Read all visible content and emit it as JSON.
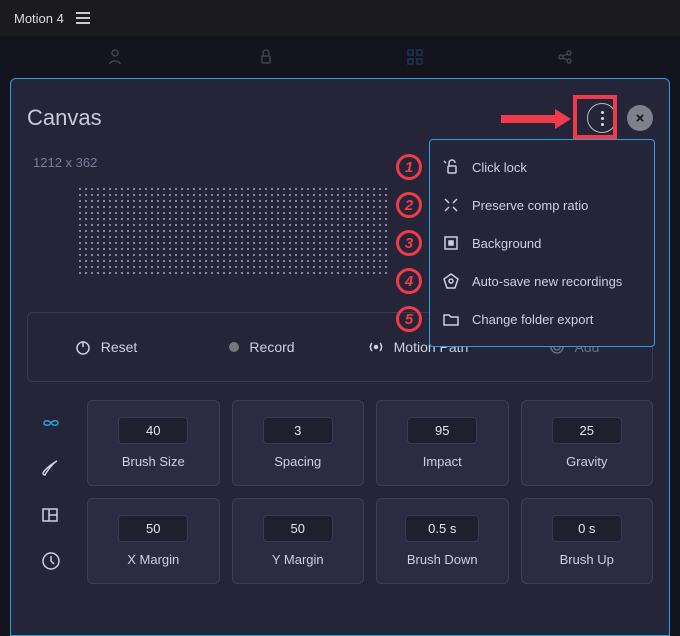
{
  "topbar": {
    "title": "Motion 4"
  },
  "panel": {
    "title": "Canvas",
    "dimensions": "1212 x 362"
  },
  "menu": {
    "items": [
      {
        "label": "Click lock",
        "icon": "lock-icon",
        "ann": "1"
      },
      {
        "label": "Preserve comp ratio",
        "icon": "expand-icon",
        "ann": "2"
      },
      {
        "label": "Background",
        "icon": "square-dot-icon",
        "ann": "3"
      },
      {
        "label": "Auto-save new recordings",
        "icon": "pentagon-icon",
        "ann": "4"
      },
      {
        "label": "Change folder export",
        "icon": "folder-icon",
        "ann": "5"
      }
    ]
  },
  "actions": {
    "reset": "Reset",
    "record": "Record",
    "motion_path": "Motion Path",
    "add": "Add"
  },
  "params": [
    {
      "value": "40",
      "label": "Brush Size"
    },
    {
      "value": "3",
      "label": "Spacing"
    },
    {
      "value": "95",
      "label": "Impact"
    },
    {
      "value": "25",
      "label": "Gravity"
    },
    {
      "value": "50",
      "label": "X Margin"
    },
    {
      "value": "50",
      "label": "Y Margin"
    },
    {
      "value": "0.5 s",
      "label": "Brush Down"
    },
    {
      "value": "0 s",
      "label": "Brush Up"
    }
  ]
}
